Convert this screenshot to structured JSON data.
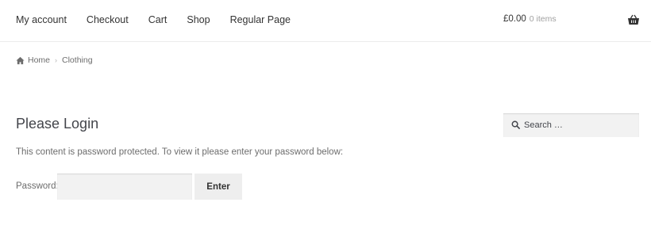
{
  "nav": {
    "items": [
      {
        "label": "My account"
      },
      {
        "label": "Checkout"
      },
      {
        "label": "Cart"
      },
      {
        "label": "Shop"
      },
      {
        "label": "Regular Page"
      }
    ]
  },
  "cart": {
    "amount": "£0.00",
    "count": "0 items",
    "icon": "basket-icon"
  },
  "breadcrumb": {
    "home": "Home",
    "separator": "›",
    "current": "Clothing",
    "icon": "home-icon"
  },
  "page": {
    "title": "Please Login",
    "notice": "This content is password protected. To view it please enter your password below:",
    "password_label": "Password:",
    "password_value": "",
    "enter_label": "Enter"
  },
  "search": {
    "placeholder": "Search …",
    "icon": "search-icon"
  }
}
